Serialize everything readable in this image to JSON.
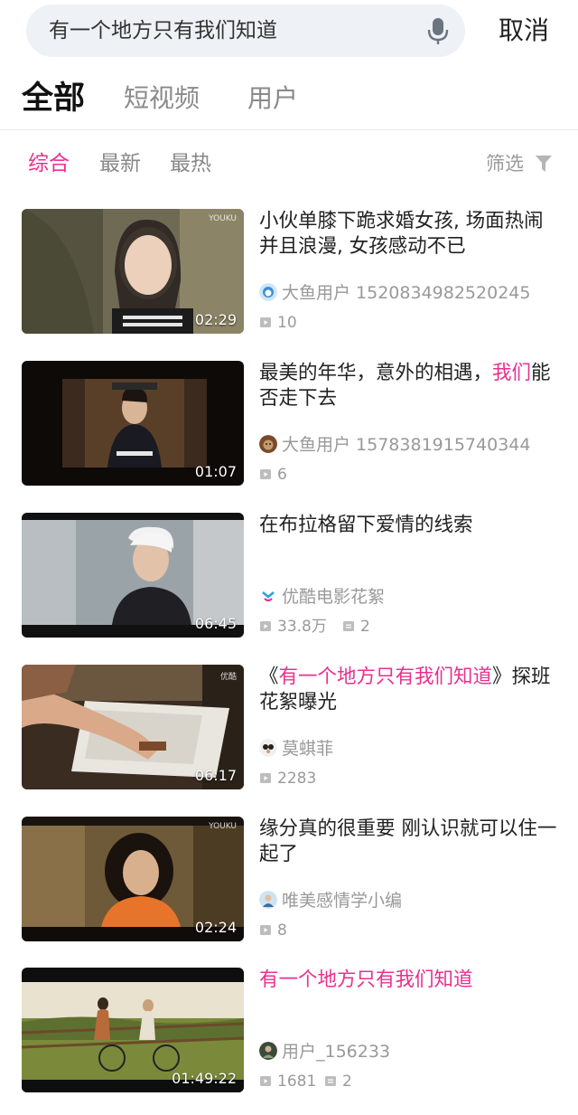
{
  "search": {
    "query": "有一个地方只有我们知道",
    "cancel_label": "取消"
  },
  "tabs": [
    "全部",
    "短视频",
    "用户"
  ],
  "sort": [
    "综合",
    "最新",
    "最热"
  ],
  "filter_label": "筛选",
  "colors": {
    "accent": "#e8308f",
    "search_bg": "#eef1f5",
    "muted": "#999999"
  },
  "videos": [
    {
      "title_pre": "小伙单膝下跪求婚女孩, 场面热闹并且浪漫, 女孩感动不已",
      "title_hl": "",
      "title_post": "",
      "author": "大鱼用户 1520834982520245",
      "plays": "10",
      "comments": "",
      "duration": "02:29",
      "watermark": "YOUKU"
    },
    {
      "title_pre": "最美的年华，意外的相遇，",
      "title_hl": "我们",
      "title_post": "能否走下去",
      "author": "大鱼用户 1578381915740344",
      "plays": "6",
      "comments": "",
      "duration": "01:07",
      "watermark": ""
    },
    {
      "title_pre": "在布拉格留下爱情的线索",
      "title_hl": "",
      "title_post": "",
      "author": "优酷电影花絮",
      "plays": "33.8万",
      "comments": "2",
      "duration": "06:45",
      "watermark": ""
    },
    {
      "title_pre": "《",
      "title_hl": "有一个地方只有我们知道",
      "title_post": "》探班花絮曝光",
      "author": "莫蜞菲",
      "plays": "2283",
      "comments": "",
      "duration": "06:17",
      "watermark": "优酷"
    },
    {
      "title_pre": "缘分真的很重要 刚认识就可以住一起了",
      "title_hl": "",
      "title_post": "",
      "author": "唯美感情学小编",
      "plays": "8",
      "comments": "",
      "duration": "02:24",
      "watermark": "YOUKU"
    },
    {
      "title_pre": "",
      "title_hl": "有一个地方只有我们知道",
      "title_post": "",
      "author": "用户_156233",
      "plays": "1681",
      "comments": "2",
      "duration": "01:49:22",
      "watermark": ""
    }
  ]
}
